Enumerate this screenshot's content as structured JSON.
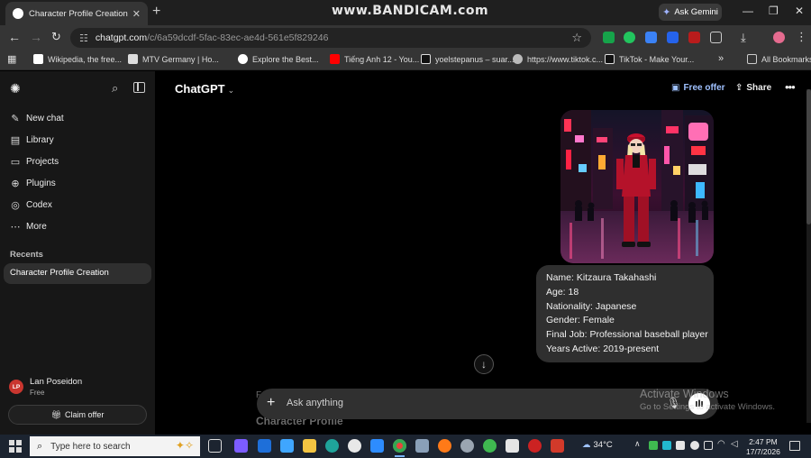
{
  "browser": {
    "tab_title": "Character Profile Creation",
    "tab_close": "✕",
    "new_tab": "+",
    "recorder_watermark": "www.BANDICAM.com",
    "ask_gemini": "Ask Gemini",
    "url_host": "chatgpt.com",
    "url_path": "/c/6a59dcdf-5fac-83ec-ae4d-561e5f829246",
    "bookmarks": [
      {
        "label": "Wikipedia, the free...",
        "icon": "wikipedia-icon",
        "color": "#ffffff"
      },
      {
        "label": "MTV Germany | Ho...",
        "icon": "mtv-icon",
        "color": "#dddddd"
      },
      {
        "label": "Explore the Best...",
        "icon": "explore-icon",
        "color": "#ffffff"
      },
      {
        "label": "Tiếng Anh 12 - You...",
        "icon": "youtube-icon",
        "color": "#ff0000"
      },
      {
        "label": "yoelstepanus – suar...",
        "icon": "tiktok-icon",
        "color": "#ffffff"
      },
      {
        "label": "https://www.tiktok.c...",
        "icon": "globe-icon",
        "color": "#bbbbbb"
      },
      {
        "label": "TikTok - Make Your...",
        "icon": "tiktok-icon",
        "color": "#ffffff"
      }
    ],
    "all_bookmarks": "All Bookmarks"
  },
  "sidebar": {
    "items": [
      {
        "label": "New chat",
        "icon": "✎",
        "name": "new-chat"
      },
      {
        "label": "Library",
        "icon": "▤",
        "name": "library"
      },
      {
        "label": "Projects",
        "icon": "▭",
        "name": "projects"
      },
      {
        "label": "Plugins",
        "icon": "⊕",
        "name": "plugins"
      },
      {
        "label": "Codex",
        "icon": "◎",
        "name": "codex"
      },
      {
        "label": "More",
        "icon": "⋯",
        "name": "more"
      }
    ],
    "recents_heading": "Recents",
    "recent_chat": "Character Profile Creation",
    "user_initials": "LP",
    "user_name": "Lan Poseidon",
    "user_plan": "Free",
    "claim_offer": "Claim offer"
  },
  "header": {
    "model": "ChatGPT",
    "free_offer": "Free offer",
    "share": "Share"
  },
  "chat": {
    "profile_lines": [
      "Name: Kitzaura Takahashi",
      "Age: 18",
      "Nationality: Japanese",
      "Gender: Female",
      "Final Job: Professional baseball player",
      "Years Active: 2019-present"
    ],
    "ghost_line_1": "F",
    "ghost_line_2": "Character Profile"
  },
  "composer": {
    "placeholder": "Ask anything"
  },
  "overlay": {
    "activate_title": "Activate Windows",
    "activate_sub": "Go to Settings to activate Windows."
  },
  "taskbar": {
    "search_placeholder": "Type here to search",
    "temperature": "34°C",
    "time": "2:47 PM",
    "date": "17/7/2026"
  }
}
